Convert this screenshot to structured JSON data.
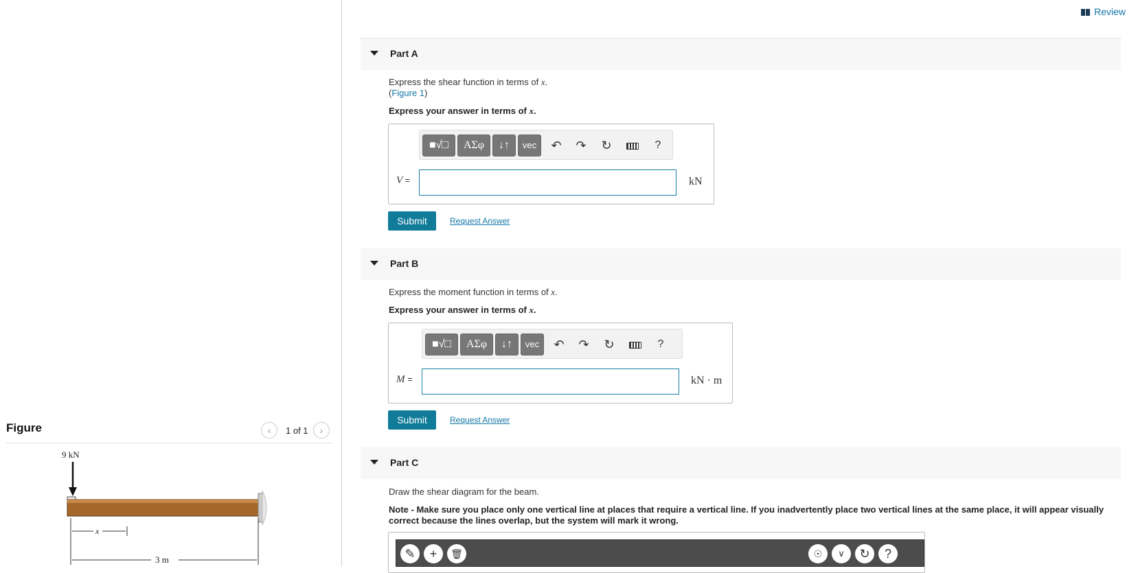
{
  "review": {
    "label": "Review"
  },
  "figure": {
    "title": "Figure",
    "prev_icon": "chevron-left-icon",
    "next_icon": "chevron-right-icon",
    "count": "1 of 1",
    "load_label": "9 kN",
    "x_label": "x",
    "length_label": "3 m"
  },
  "parts": {
    "a": {
      "label": "Part A",
      "prompt_prefix": "Express the shear function in terms of ",
      "prompt_var": "x",
      "prompt_suffix": ".",
      "figure_link": "Figure 1",
      "instruction_prefix": "Express your answer in terms of ",
      "instruction_var": "x",
      "instruction_suffix": ".",
      "variable": "V",
      "unit": "kN",
      "input_value": "",
      "submit": "Submit",
      "request": "Request Answer"
    },
    "b": {
      "label": "Part B",
      "prompt_prefix": "Express the moment function in terms of ",
      "prompt_var": "x",
      "prompt_suffix": ".",
      "instruction_prefix": "Express your answer in terms of ",
      "instruction_var": "x",
      "instruction_suffix": ".",
      "variable": "M",
      "unit": "kN · m",
      "input_value": "",
      "submit": "Submit",
      "request": "Request Answer"
    },
    "c": {
      "label": "Part C",
      "prompt": "Draw the shear diagram for the beam.",
      "note": "Note - Make sure you place only one vertical line at places that require a vertical line. If you inadvertently place two vertical lines at the same place, it will appear visually correct because the lines overlap, but the system will mark it wrong."
    }
  },
  "toolbar": {
    "templates": "■√□",
    "greek": "ΑΣφ",
    "arrows": "↓↑",
    "vec": "vec",
    "undo_icon": "undo-icon",
    "redo_icon": "redo-icon",
    "reset_icon": "reset-icon",
    "keyboard_icon": "keyboard-icon",
    "help": "?"
  },
  "graph_tools": {
    "pencil_icon": "pencil-plus-icon",
    "add_icon": "plus-icon",
    "delete_icon": "trash-icon",
    "hint_icon": "lightbulb-icon",
    "menu_icon": "chevron-down-icon",
    "reset_icon": "reset-icon",
    "help": "?"
  }
}
